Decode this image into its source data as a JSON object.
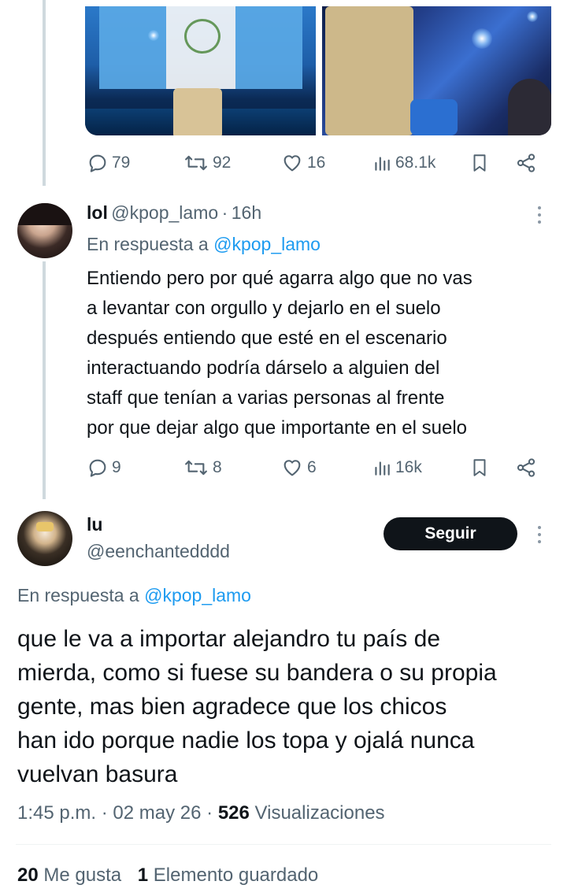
{
  "first_tweet": {
    "actions": {
      "replies": "79",
      "reposts": "92",
      "likes": "16",
      "views": "68.1k"
    }
  },
  "reply": {
    "name": "lol",
    "handle": "@kpop_lamo",
    "time": "16h",
    "separator": "·",
    "reply_prefix": "En respuesta a",
    "reply_to": "@kpop_lamo",
    "text_lines": [
      "Entiendo pero por qué agarra algo que no vas",
      "a levantar con orgullo y dejarlo en el suelo",
      "después entiendo que esté en el escenario",
      "interactuando podría dárselo a alguien del",
      "staff que tenían a varias personas al frente",
      "por que dejar algo que importante en el suelo"
    ],
    "actions": {
      "replies": "9",
      "reposts": "8",
      "likes": "6",
      "views": "16k"
    }
  },
  "main_tweet": {
    "name": "lu",
    "handle": "@eenchantedddd",
    "follow_label": "Seguir",
    "reply_prefix": "En respuesta a",
    "reply_to": "@kpop_lamo",
    "text_lines": [
      "que le va a importar alejandro tu país de",
      "mierda, como si fuese su bandera o su propia",
      "gente, mas bien agradece que los chicos",
      "han ido porque nadie los topa y ojalá nunca",
      "vuelvan basura"
    ],
    "time": "1:45 p.m.",
    "date": "02 may 26",
    "sep": "·",
    "views_count": "526",
    "views_label": "Visualizaciones",
    "likes_count": "20",
    "likes_label": "Me gusta",
    "bookmarks_count": "1",
    "bookmarks_label": "Elemento guardado"
  },
  "colors": {
    "accent": "#1d9bf0",
    "text": "#0f1419",
    "secondary": "#536471",
    "line": "#cfd9de"
  }
}
